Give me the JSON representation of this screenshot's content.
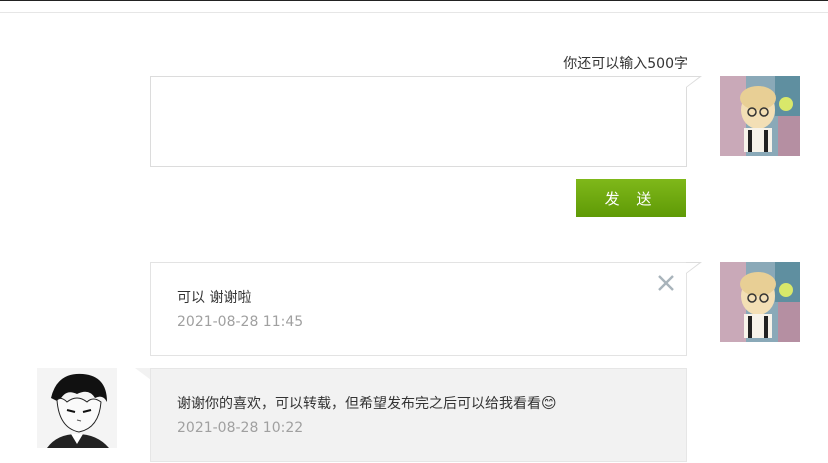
{
  "composer": {
    "remaining_label": "你还可以输入500字",
    "textarea_value": "",
    "send_label": "发 送"
  },
  "messages": [
    {
      "text": "可以 谢谢啦",
      "time": "2021-08-28 11:45",
      "side": "right",
      "avatar": "avatar-figure-icon",
      "deletable": true
    },
    {
      "text": "谢谢你的喜欢，可以转载，但希望发布完之后可以给我看看",
      "time": "2021-08-28 10:22",
      "side": "left",
      "avatar": "avatar-manga-boy-icon",
      "emoji": "😊"
    }
  ],
  "colors": {
    "send_button": "#6aa30a",
    "reply_bubble_bg": "#f2f2f2",
    "time_text": "#a0a0a0"
  }
}
